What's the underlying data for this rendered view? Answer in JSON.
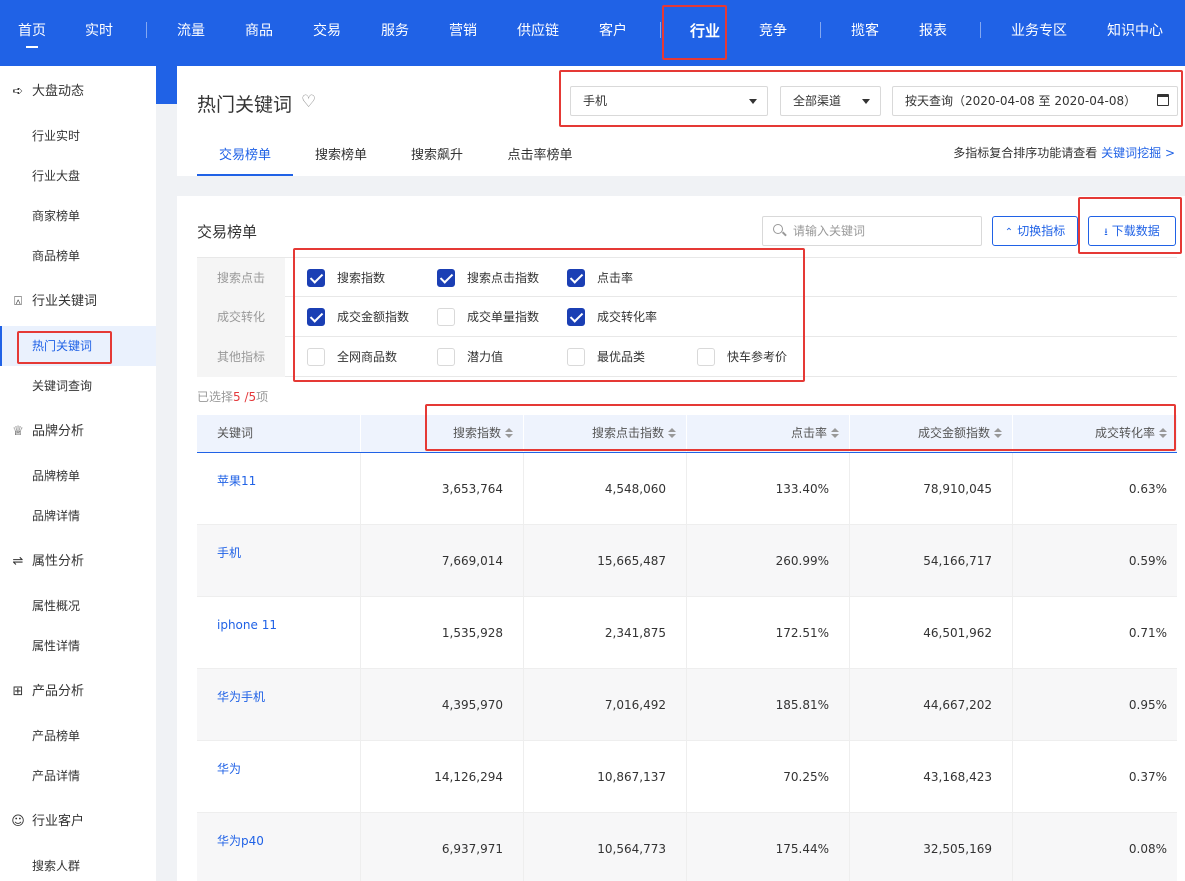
{
  "nav": {
    "items": [
      "首页",
      "实时",
      "流量",
      "商品",
      "交易",
      "服务",
      "营销",
      "供应链",
      "客户",
      "行业",
      "竞争",
      "揽客",
      "报表",
      "业务专区",
      "知识中心"
    ]
  },
  "sidebar": {
    "groups": [
      {
        "label": "大盘动态",
        "icon": "arrow-right-icon",
        "items": [
          "行业实时",
          "行业大盘",
          "商家榜单",
          "商品榜单"
        ]
      },
      {
        "label": "行业关键词",
        "icon": "keyword-icon",
        "items": [
          "热门关键词",
          "关键词查询"
        ]
      },
      {
        "label": "品牌分析",
        "icon": "crown-icon",
        "items": [
          "品牌榜单",
          "品牌详情"
        ]
      },
      {
        "label": "属性分析",
        "icon": "attribute-icon",
        "items": [
          "属性概况",
          "属性详情"
        ]
      },
      {
        "label": "产品分析",
        "icon": "cart-icon",
        "items": [
          "产品榜单",
          "产品详情"
        ]
      },
      {
        "label": "行业客户",
        "icon": "customer-icon",
        "items": [
          "搜索人群"
        ]
      }
    ],
    "active_item": "热门关键词"
  },
  "header": {
    "title": "热门关键词",
    "category_select": "手机",
    "channel_select": "全部渠道",
    "date_select": "按天查询（2020-04-08 至 2020-04-08）",
    "tabs": [
      "交易榜单",
      "搜索榜单",
      "搜索飙升",
      "点击率榜单"
    ],
    "active_tab": "交易榜单",
    "tip_text": "多指标复合排序功能请查看",
    "tip_link": "关键词挖掘 >"
  },
  "main": {
    "title": "交易榜单",
    "search_placeholder": "请输入关键词",
    "switch_button": "切换指标",
    "download_button": "下载数据",
    "metric_groups": [
      {
        "label": "搜索点击",
        "options": [
          {
            "label": "搜索指数",
            "checked": true
          },
          {
            "label": "搜索点击指数",
            "checked": true
          },
          {
            "label": "点击率",
            "checked": true
          }
        ]
      },
      {
        "label": "成交转化",
        "options": [
          {
            "label": "成交金额指数",
            "checked": true
          },
          {
            "label": "成交单量指数",
            "checked": false
          },
          {
            "label": "成交转化率",
            "checked": true
          }
        ]
      },
      {
        "label": "其他指标",
        "options": [
          {
            "label": "全网商品数",
            "checked": false
          },
          {
            "label": "潜力值",
            "checked": false
          },
          {
            "label": "最优品类",
            "checked": false
          },
          {
            "label": "快车参考价",
            "checked": false
          }
        ]
      }
    ],
    "selected_prefix": "已选择",
    "selected_count": "5",
    "selected_total": " /5",
    "selected_suffix": "项"
  },
  "table": {
    "columns": [
      "关键词",
      "搜索指数",
      "搜索点击指数",
      "点击率",
      "成交金额指数",
      "成交转化率"
    ],
    "rows": [
      [
        "苹果11",
        "3,653,764",
        "4,548,060",
        "133.40%",
        "78,910,045",
        "0.63%"
      ],
      [
        "手机",
        "7,669,014",
        "15,665,487",
        "260.99%",
        "54,166,717",
        "0.59%"
      ],
      [
        "iphone 11",
        "1,535,928",
        "2,341,875",
        "172.51%",
        "46,501,962",
        "0.71%"
      ],
      [
        "华为手机",
        "4,395,970",
        "7,016,492",
        "185.81%",
        "44,667,202",
        "0.95%"
      ],
      [
        "华为",
        "14,126,294",
        "10,867,137",
        "70.25%",
        "43,168,423",
        "0.37%"
      ],
      [
        "华为p40",
        "6,937,971",
        "10,564,773",
        "175.44%",
        "32,505,169",
        "0.08%"
      ]
    ]
  },
  "colors": {
    "brand_blue": "#2062e6",
    "checkbox_blue": "#1b3fb4",
    "highlight_red": "#e53935"
  }
}
